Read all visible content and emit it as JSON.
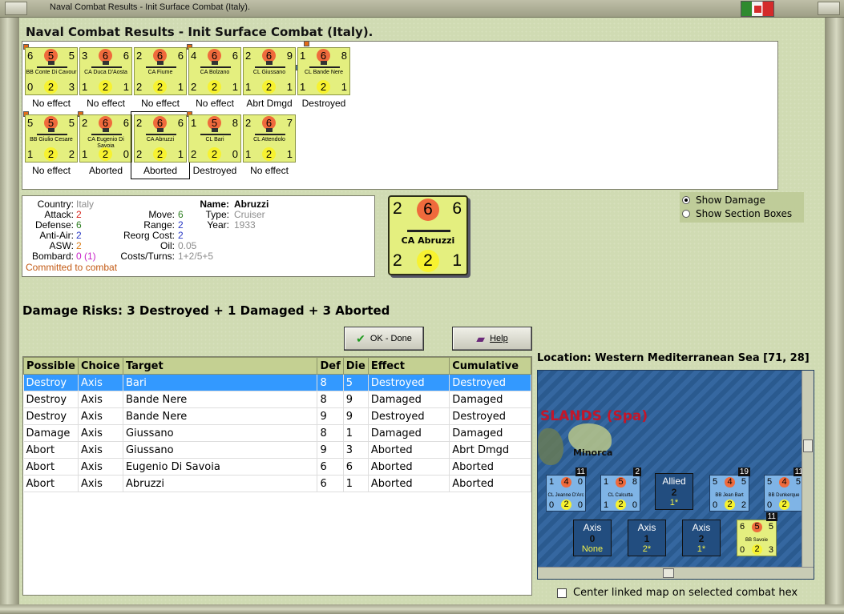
{
  "window": {
    "title": "Naval Combat Results - Init Surface Combat (Italy)."
  },
  "heading": "Naval Combat Results - Init Surface Combat (Italy).",
  "ships_row1": [
    {
      "tl": "6",
      "tc": "5",
      "tr": "5",
      "name": "BB Conte Di Cavour",
      "bl": "0",
      "bc": "2",
      "br": "3",
      "result": "No effect"
    },
    {
      "tl": "3",
      "tc": "6",
      "tr": "6",
      "name": "CA Duca D'Aosta",
      "bl": "1",
      "bc": "2",
      "br": "1",
      "result": "No effect"
    },
    {
      "tl": "2",
      "tc": "6",
      "tr": "6",
      "name": "CA Fiume",
      "bl": "2",
      "bc": "2",
      "br": "1",
      "result": "No effect"
    },
    {
      "tl": "4",
      "tc": "6",
      "tr": "6",
      "name": "CA Bolzano",
      "bl": "2",
      "bc": "2",
      "br": "1",
      "result": "No effect"
    },
    {
      "tl": "2",
      "tc": "6",
      "tr": "9",
      "name": "CL Giussano",
      "bl": "1",
      "bc": "2",
      "br": "1",
      "result": "Abrt Dmgd"
    },
    {
      "tl": "1",
      "tc": "6",
      "tr": "8",
      "name": "CL Bande Nere",
      "bl": "1",
      "bc": "2",
      "br": "1",
      "result": "Destroyed"
    }
  ],
  "ships_row2": [
    {
      "tl": "5",
      "tc": "5",
      "tr": "5",
      "name": "BB Giulio Cesare",
      "bl": "1",
      "bc": "2",
      "br": "2",
      "result": "No effect"
    },
    {
      "tl": "2",
      "tc": "6",
      "tr": "6",
      "name": "CA Eugenio Di Savoia",
      "bl": "1",
      "bc": "2",
      "br": "0",
      "result": "Aborted"
    },
    {
      "tl": "2",
      "tc": "6",
      "tr": "6",
      "name": "CA Abruzzi",
      "bl": "2",
      "bc": "2",
      "br": "1",
      "result": "Aborted"
    },
    {
      "tl": "1",
      "tc": "5",
      "tr": "8",
      "name": "CL Bari",
      "bl": "2",
      "bc": "2",
      "br": "0",
      "result": "Destroyed"
    },
    {
      "tl": "2",
      "tc": "6",
      "tr": "7",
      "name": "CL Attendolo",
      "bl": "1",
      "bc": "2",
      "br": "1",
      "result": "No effect"
    }
  ],
  "details": {
    "country_label": "Country:",
    "country": "Italy",
    "attack_label": "Attack:",
    "attack": "2",
    "defense_label": "Defense:",
    "defense": "6",
    "antiair_label": "Anti-Air:",
    "antiair": "2",
    "asw_label": "ASW:",
    "asw": "2",
    "bombard_label": "Bombard:",
    "bombard": "0 (1)",
    "committed": "Committed to combat",
    "name_label": "Name:",
    "name": "Abruzzi",
    "type_label": "Type:",
    "type": "Cruiser",
    "year_label": "Year:",
    "year": "1933",
    "move_label": "Move:",
    "move": "6",
    "range_label": "Range:",
    "range": "2",
    "reorg_label": "Reorg Cost:",
    "reorg": "2",
    "oil_label": "Oil:",
    "oil": "0.05",
    "costs_label": "Costs/Turns:",
    "costs": "1+2/5+5"
  },
  "big_counter": {
    "tl": "2",
    "tc": "6",
    "tr": "6",
    "name": "CA Abruzzi",
    "bl": "2",
    "bc": "2",
    "br": "1"
  },
  "options": {
    "show_damage": "Show Damage",
    "show_sections": "Show Section Boxes"
  },
  "risk": "Damage Risks: 3 Destroyed + 1 Damaged + 3 Aborted",
  "buttons": {
    "ok": "OK - Done",
    "help": "Help"
  },
  "table": {
    "headers": [
      "Possible",
      "Choice",
      "Target",
      "Def",
      "Die",
      "Effect",
      "Cumulative"
    ],
    "rows": [
      [
        "Destroy",
        "Axis",
        "Bari",
        "8",
        "5",
        "Destroyed",
        "Destroyed"
      ],
      [
        "Destroy",
        "Axis",
        "Bande Nere",
        "8",
        "9",
        "Damaged",
        "Damaged"
      ],
      [
        "Destroy",
        "Axis",
        "Bande Nere",
        "9",
        "9",
        "Destroyed",
        "Destroyed"
      ],
      [
        "Damage",
        "Axis",
        "Giussano",
        "8",
        "1",
        "Damaged",
        "Damaged"
      ],
      [
        "Abort",
        "Axis",
        "Giussano",
        "9",
        "3",
        "Aborted",
        "Abrt Dmgd"
      ],
      [
        "Abort",
        "Axis",
        "Eugenio Di Savoia",
        "6",
        "6",
        "Aborted",
        "Aborted"
      ],
      [
        "Abort",
        "Axis",
        "Abruzzi",
        "6",
        "1",
        "Aborted",
        "Aborted"
      ]
    ]
  },
  "location": "Location:  Western Mediterranean Sea [71, 28]",
  "map": {
    "region_label": "SLANDS (Spa)",
    "place_label": "Minorca",
    "counters": [
      {
        "tl": "1",
        "tc": "4",
        "tr": "0",
        "name": "CL Jeanne D'Arc",
        "bl": "0",
        "bc": "2",
        "br": "0",
        "stack": "11"
      },
      {
        "tl": "1",
        "tc": "5",
        "tr": "8",
        "name": "CL Calcutta",
        "bl": "1",
        "bc": "2",
        "br": "0",
        "stack": "2"
      },
      {
        "tl": "5",
        "tc": "4",
        "tr": "5",
        "name": "BB Jean Bart",
        "bl": "0",
        "bc": "2",
        "br": "2",
        "stack": "19"
      },
      {
        "tl": "5",
        "tc": "4",
        "tr": "5",
        "name": "BB Dunkerque",
        "bl": "0",
        "bc": "2",
        "br": "",
        "stack": "11"
      }
    ],
    "allied_box": {
      "side": "Allied",
      "count": "2",
      "sub": "1*"
    },
    "axis_boxes": [
      {
        "side": "Axis",
        "count": "0",
        "sub": "None"
      },
      {
        "side": "Axis",
        "count": "1",
        "sub": "2*"
      },
      {
        "side": "Axis",
        "count": "2",
        "sub": "1*"
      }
    ],
    "axis_counter": {
      "tl": "6",
      "tc": "5",
      "tr": "5",
      "name": "BB Savoie",
      "bl": "0",
      "bc": "2",
      "br": "3",
      "stack": "11"
    }
  },
  "center_check": "Center linked map on selected combat hex"
}
